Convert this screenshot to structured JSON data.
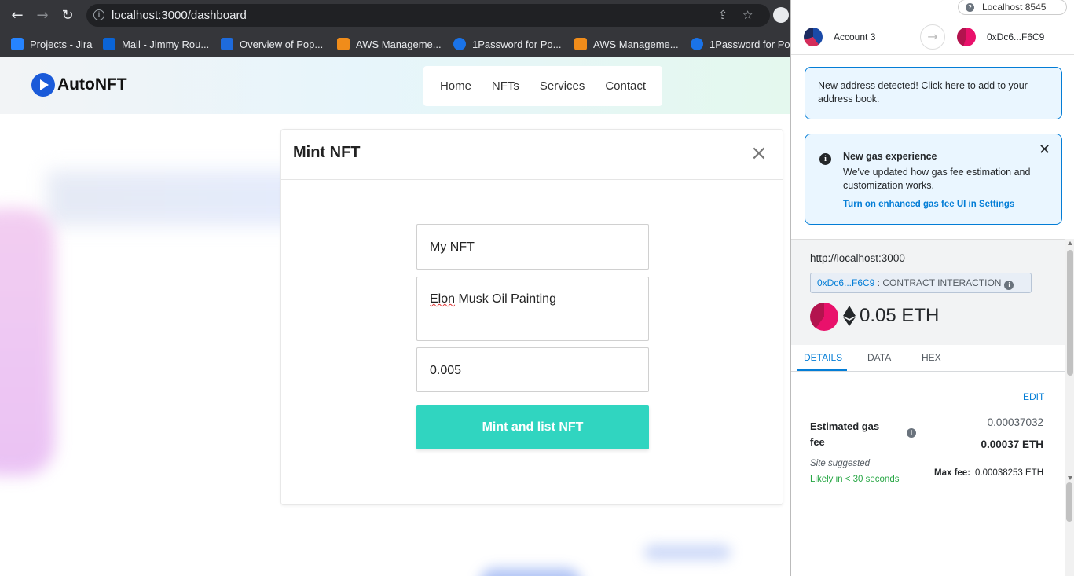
{
  "browser": {
    "url": "localhost:3000/dashboard",
    "bookmarks": [
      {
        "label": "Projects - Jira",
        "color": "#2684ff"
      },
      {
        "label": "Mail - Jimmy Rou...",
        "color": "#0a64d6"
      },
      {
        "label": "Overview of Pop...",
        "color": "#1e6bdc"
      },
      {
        "label": "AWS Manageme...",
        "color": "#f08c1a"
      },
      {
        "label": "1Password for Po...",
        "color": "#1a73e8"
      },
      {
        "label": "AWS Manageme...",
        "color": "#f08c1a"
      },
      {
        "label": "1Password for Po",
        "color": "#1a73e8"
      }
    ]
  },
  "site": {
    "brand": "AutoNFT",
    "nav": [
      "Home",
      "NFTs",
      "Services",
      "Contact"
    ]
  },
  "modal": {
    "title": "Mint NFT",
    "name_value": "My NFT",
    "description_value_word": "Elon",
    "description_value_rest": " Musk Oil Painting",
    "price_value": "0.005",
    "submit_label": "Mint and list NFT",
    "accent": "#30d5c0"
  },
  "metamask": {
    "network": "Localhost 8545",
    "from_account": "Account 3",
    "to_account": "0xDc6...F6C9",
    "address_notice": "New address detected! Click here to add to your address book.",
    "gas_notice": {
      "title": "New gas experience",
      "body": "We've updated how gas fee estimation and customization works.",
      "link": "Turn on enhanced gas fee UI in Settings"
    },
    "origin": "http://localhost:3000",
    "contract_addr": "0xDc6...F6C9",
    "contract_label": " : CONTRACT INTERACTION",
    "amount": "0.05 ETH",
    "tabs": [
      "DETAILS",
      "DATA",
      "HEX"
    ],
    "edit": "EDIT",
    "gas_label": "Estimated gas fee",
    "gas_value_1": "0.00037032",
    "gas_value_2": "0.00037 ETH",
    "site_suggested": "Site suggested",
    "likely": "Likely in < 30 seconds",
    "max_fee_label": "Max fee:",
    "max_fee_value": "0.00038253 ETH",
    "link_color": "#037dd6"
  }
}
